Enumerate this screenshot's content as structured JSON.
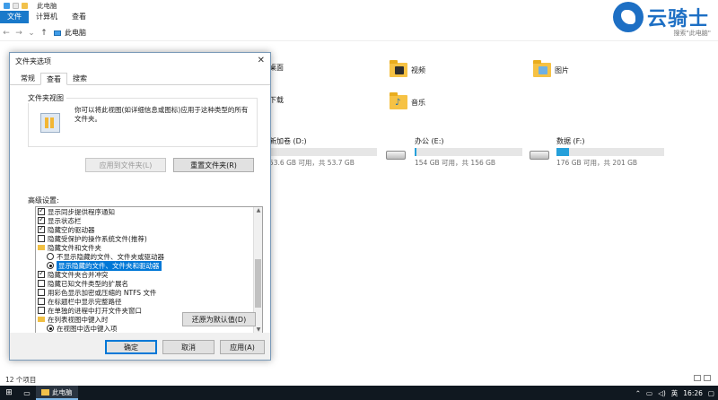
{
  "window": {
    "title": "此电脑"
  },
  "ribbon": {
    "tabs": [
      "文件",
      "计算机",
      "查看"
    ]
  },
  "address": {
    "path": "此电脑",
    "search_placeholder": "搜索\"此电脑\""
  },
  "folders": [
    {
      "label": "桌面"
    },
    {
      "label": "视频"
    },
    {
      "label": "图片"
    },
    {
      "label": "下载"
    },
    {
      "label": "音乐"
    }
  ],
  "drives": [
    {
      "name": "新加卷 (D:)",
      "info": "53.6 GB 可用，共 53.7 GB",
      "used_fraction": 0.01
    },
    {
      "name": "办公 (E:)",
      "info": "154 GB 可用，共 156 GB",
      "used_fraction": 0.02
    },
    {
      "name": "数据 (F:)",
      "info": "176 GB 可用，共 201 GB",
      "used_fraction": 0.12
    }
  ],
  "status": {
    "item_count": "12 个项目"
  },
  "dialog": {
    "title": "文件夹选项",
    "tabs": [
      "常规",
      "查看",
      "搜索"
    ],
    "folder_views": {
      "title": "文件夹视图",
      "description": "你可以将此视图(如详细信息或图标)应用于这种类型的所有文件夹。",
      "apply_button": "应用到文件夹(L)",
      "reset_button": "重置文件夹(R)"
    },
    "advanced_label": "高级设置:",
    "settings": [
      {
        "type": "checkbox",
        "checked": true,
        "label": "显示同步提供程序通知",
        "indent": 0
      },
      {
        "type": "checkbox",
        "checked": true,
        "label": "显示状态栏",
        "indent": 0
      },
      {
        "type": "checkbox",
        "checked": true,
        "label": "隐藏空的驱动器",
        "indent": 0
      },
      {
        "type": "checkbox",
        "checked": false,
        "label": "隐藏受保护的操作系统文件(推荐)",
        "indent": 0
      },
      {
        "type": "folder",
        "checked": false,
        "label": "隐藏文件和文件夹",
        "indent": 0
      },
      {
        "type": "radio",
        "checked": false,
        "label": "不显示隐藏的文件、文件夹或驱动器",
        "indent": 1
      },
      {
        "type": "radio",
        "checked": true,
        "label": "显示隐藏的文件、文件夹和驱动器",
        "indent": 1,
        "selected": true
      },
      {
        "type": "checkbox",
        "checked": true,
        "label": "隐藏文件夹合并冲突",
        "indent": 0
      },
      {
        "type": "checkbox",
        "checked": false,
        "label": "隐藏已知文件类型的扩展名",
        "indent": 0
      },
      {
        "type": "checkbox",
        "checked": false,
        "label": "用彩色显示加密或压缩的 NTFS 文件",
        "indent": 0
      },
      {
        "type": "checkbox",
        "checked": false,
        "label": "在标题栏中显示完整路径",
        "indent": 0
      },
      {
        "type": "checkbox",
        "checked": false,
        "label": "在单独的进程中打开文件夹窗口",
        "indent": 0
      },
      {
        "type": "folder",
        "checked": false,
        "label": "在列表视图中键入时",
        "indent": 0
      },
      {
        "type": "radio",
        "checked": true,
        "label": "在视图中选中键入项",
        "indent": 1
      }
    ],
    "restore_button": "还原为默认值(D)",
    "ok_button": "确定",
    "cancel_button": "取消",
    "apply_button": "应用(A)"
  },
  "taskbar": {
    "app_label": "此电脑",
    "ime": "英",
    "time": "16:26"
  },
  "watermark": {
    "text": "云骑士"
  }
}
